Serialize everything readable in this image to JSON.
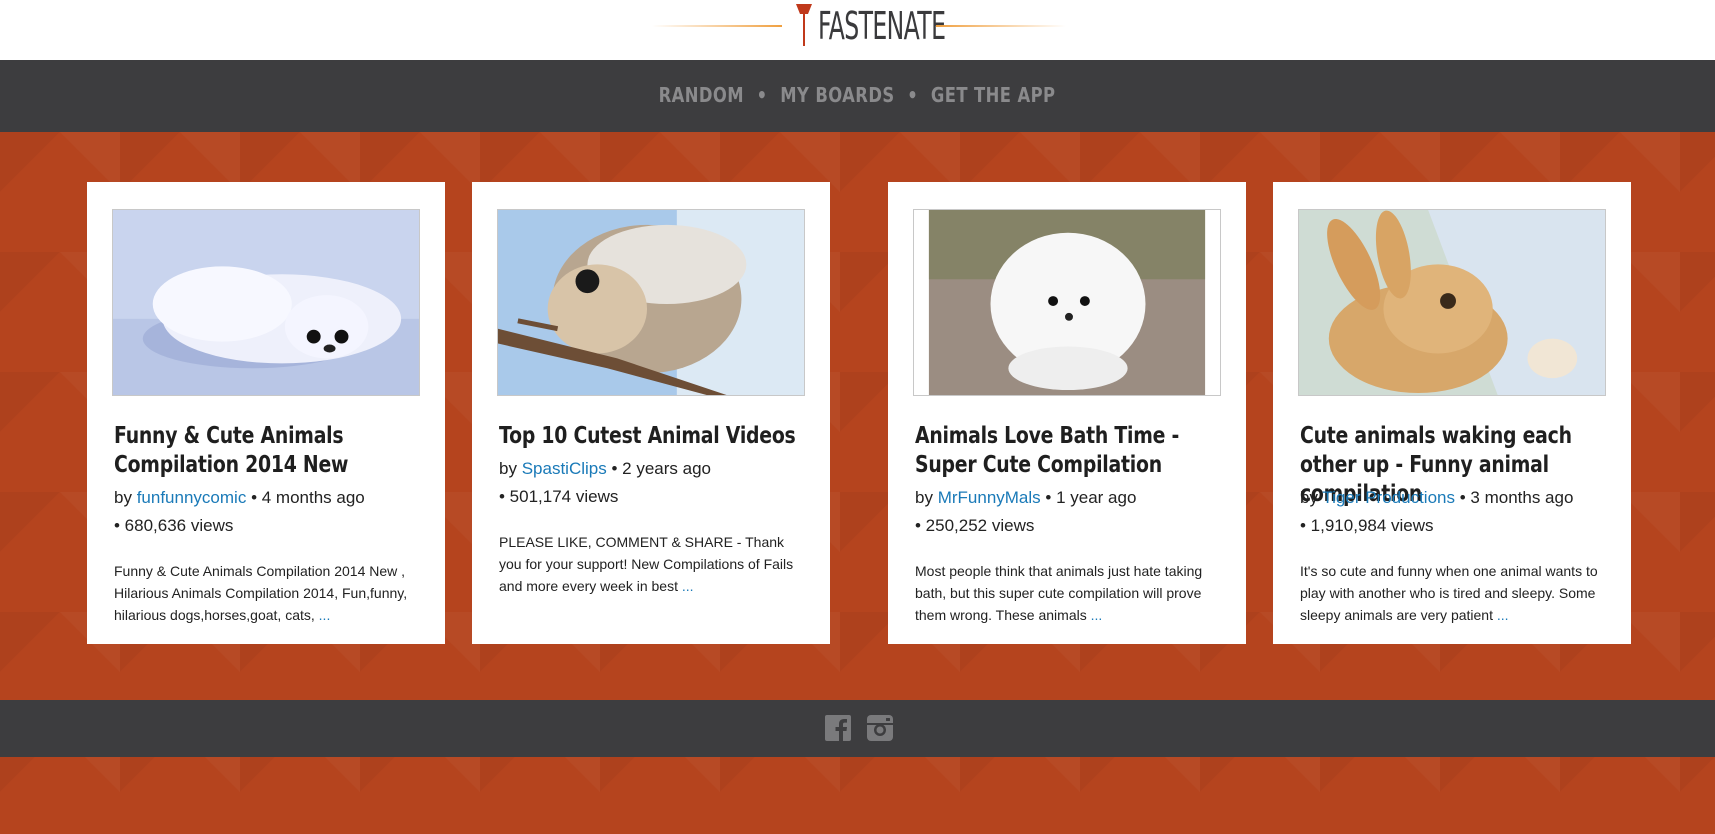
{
  "brand": {
    "name": "FASTENATE",
    "accent": "#f0a040",
    "mark_color": "#c0391b"
  },
  "nav": {
    "items": [
      {
        "label": "RANDOM"
      },
      {
        "label": "MY BOARDS"
      },
      {
        "label": "GET THE APP"
      }
    ],
    "separator": "•"
  },
  "colors": {
    "background": "#b5441e",
    "bar": "#3d3d3f",
    "link": "#1a7ab8"
  },
  "cards": [
    {
      "title": "Funny & Cute Animals Compilation 2014 New",
      "by": "by",
      "author": "funfunnycomic",
      "age": "• 4 months ago",
      "views": "• 680,636 views",
      "description": "Funny & Cute Animals Compilation 2014 New , Hilarious Animals Compilation 2014, Fun,funny, hilarious dogs,horses,goat, cats,",
      "more": "...",
      "thumb_icon": "seal-pup-thumbnail"
    },
    {
      "title": "Top 10 Cutest Animal Videos",
      "by": "by",
      "author": "SpastiClips",
      "age": "• 2 years ago",
      "views": "• 501,174 views",
      "description": "PLEASE LIKE, COMMENT & SHARE - Thank you for your support! New Compilations of Fails and more every week in best",
      "more": "...",
      "thumb_icon": "flying-squirrel-thumbnail"
    },
    {
      "title": "Animals Love Bath Time - Super Cute Compilation",
      "by": "by",
      "author": "MrFunnyMals",
      "age": "• 1 year ago",
      "views": "• 250,252 views",
      "description": "Most people think that animals just hate taking bath, but this super cute compilation will prove them wrong. These animals",
      "more": "...",
      "thumb_icon": "white-puppy-thumbnail"
    },
    {
      "title": "Cute animals waking each other up - Funny animal compilation",
      "by": "by",
      "author": "Tiger Productions",
      "age": "• 3 months ago",
      "views": "• 1,910,984 views",
      "description": "It's so cute and funny when one animal wants to play with another who is tired and sleepy. Some sleepy animals are very patient",
      "more": "...",
      "thumb_icon": "bunny-thumbnail"
    }
  ],
  "footer": {
    "social": [
      {
        "icon": "facebook-icon"
      },
      {
        "icon": "instagram-icon"
      }
    ]
  }
}
